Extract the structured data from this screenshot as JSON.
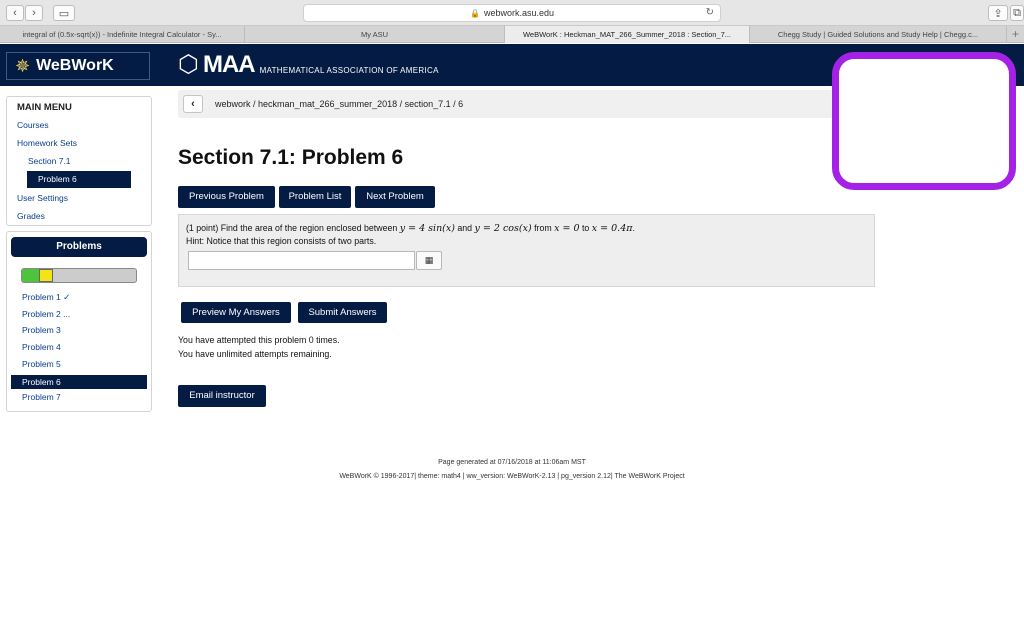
{
  "browser": {
    "url": "webwork.asu.edu",
    "tabs": [
      "integral of (0.5x-sqrt(x)) - Indefinite Integral Calculator - Sy...",
      "My ASU",
      "WeBWorK : Heckman_MAT_266_Summer_2018 : Section_7...",
      "Chegg Study | Guided Solutions and Study Help | Chegg.c..."
    ]
  },
  "header": {
    "logo_text": "WeBWorK",
    "maa_text": "MAA",
    "maa_sub": "MATHEMATICAL ASSOCIATION OF AMERICA"
  },
  "sidebar": {
    "title": "MAIN MENU",
    "items": [
      "Courses",
      "Homework Sets",
      "Section 7.1",
      "Problem 6",
      "User Settings",
      "Grades"
    ]
  },
  "problems_panel": {
    "title": "Problems",
    "progress": {
      "correct_fraction": 0.14,
      "partial_fraction": 0.12
    },
    "items": [
      "Problem 1 ✓",
      "Problem 2 ...",
      "Problem 3",
      "Problem 4",
      "Problem 5",
      "Problem 6",
      "Problem 7"
    ]
  },
  "breadcrumb": {
    "text": "webwork / heckman_mat_266_summer_2018 / section_7.1 / 6"
  },
  "page": {
    "title": "Section 7.1: Problem 6",
    "nav_buttons": [
      "Previous Problem",
      "Problem List",
      "Next Problem"
    ],
    "problem": {
      "prefix": "(1 point) Find the area of the region enclosed between ",
      "eq1": "y = 4 sin(x)",
      "and": " and ",
      "eq2": "y = 2 cos(x)",
      "from": " from ",
      "eq3": "x = 0",
      "to": " to ",
      "eq4": "x = 0.4π",
      "end": ".",
      "hint": "Hint: Notice that this region consists of two parts."
    },
    "answer_value": "",
    "submit_buttons": [
      "Preview My Answers",
      "Submit Answers"
    ],
    "attempts_line1": "You have attempted this problem 0 times.",
    "attempts_line2": "You have unlimited attempts remaining.",
    "email_button": "Email instructor"
  },
  "footer": {
    "line1": "Page generated at 07/16/2018 at 11:06am MST",
    "line2": "WeBWorK © 1996-2017| theme: math4 | ww_version: WeBWorK-2.13 | pg_version 2.12| The WeBWorK Project"
  },
  "colors": {
    "navy": "#041b44",
    "overlay_purple": "#a322e6",
    "progress_green": "#4ec43c",
    "progress_yellow": "#f4e416"
  }
}
